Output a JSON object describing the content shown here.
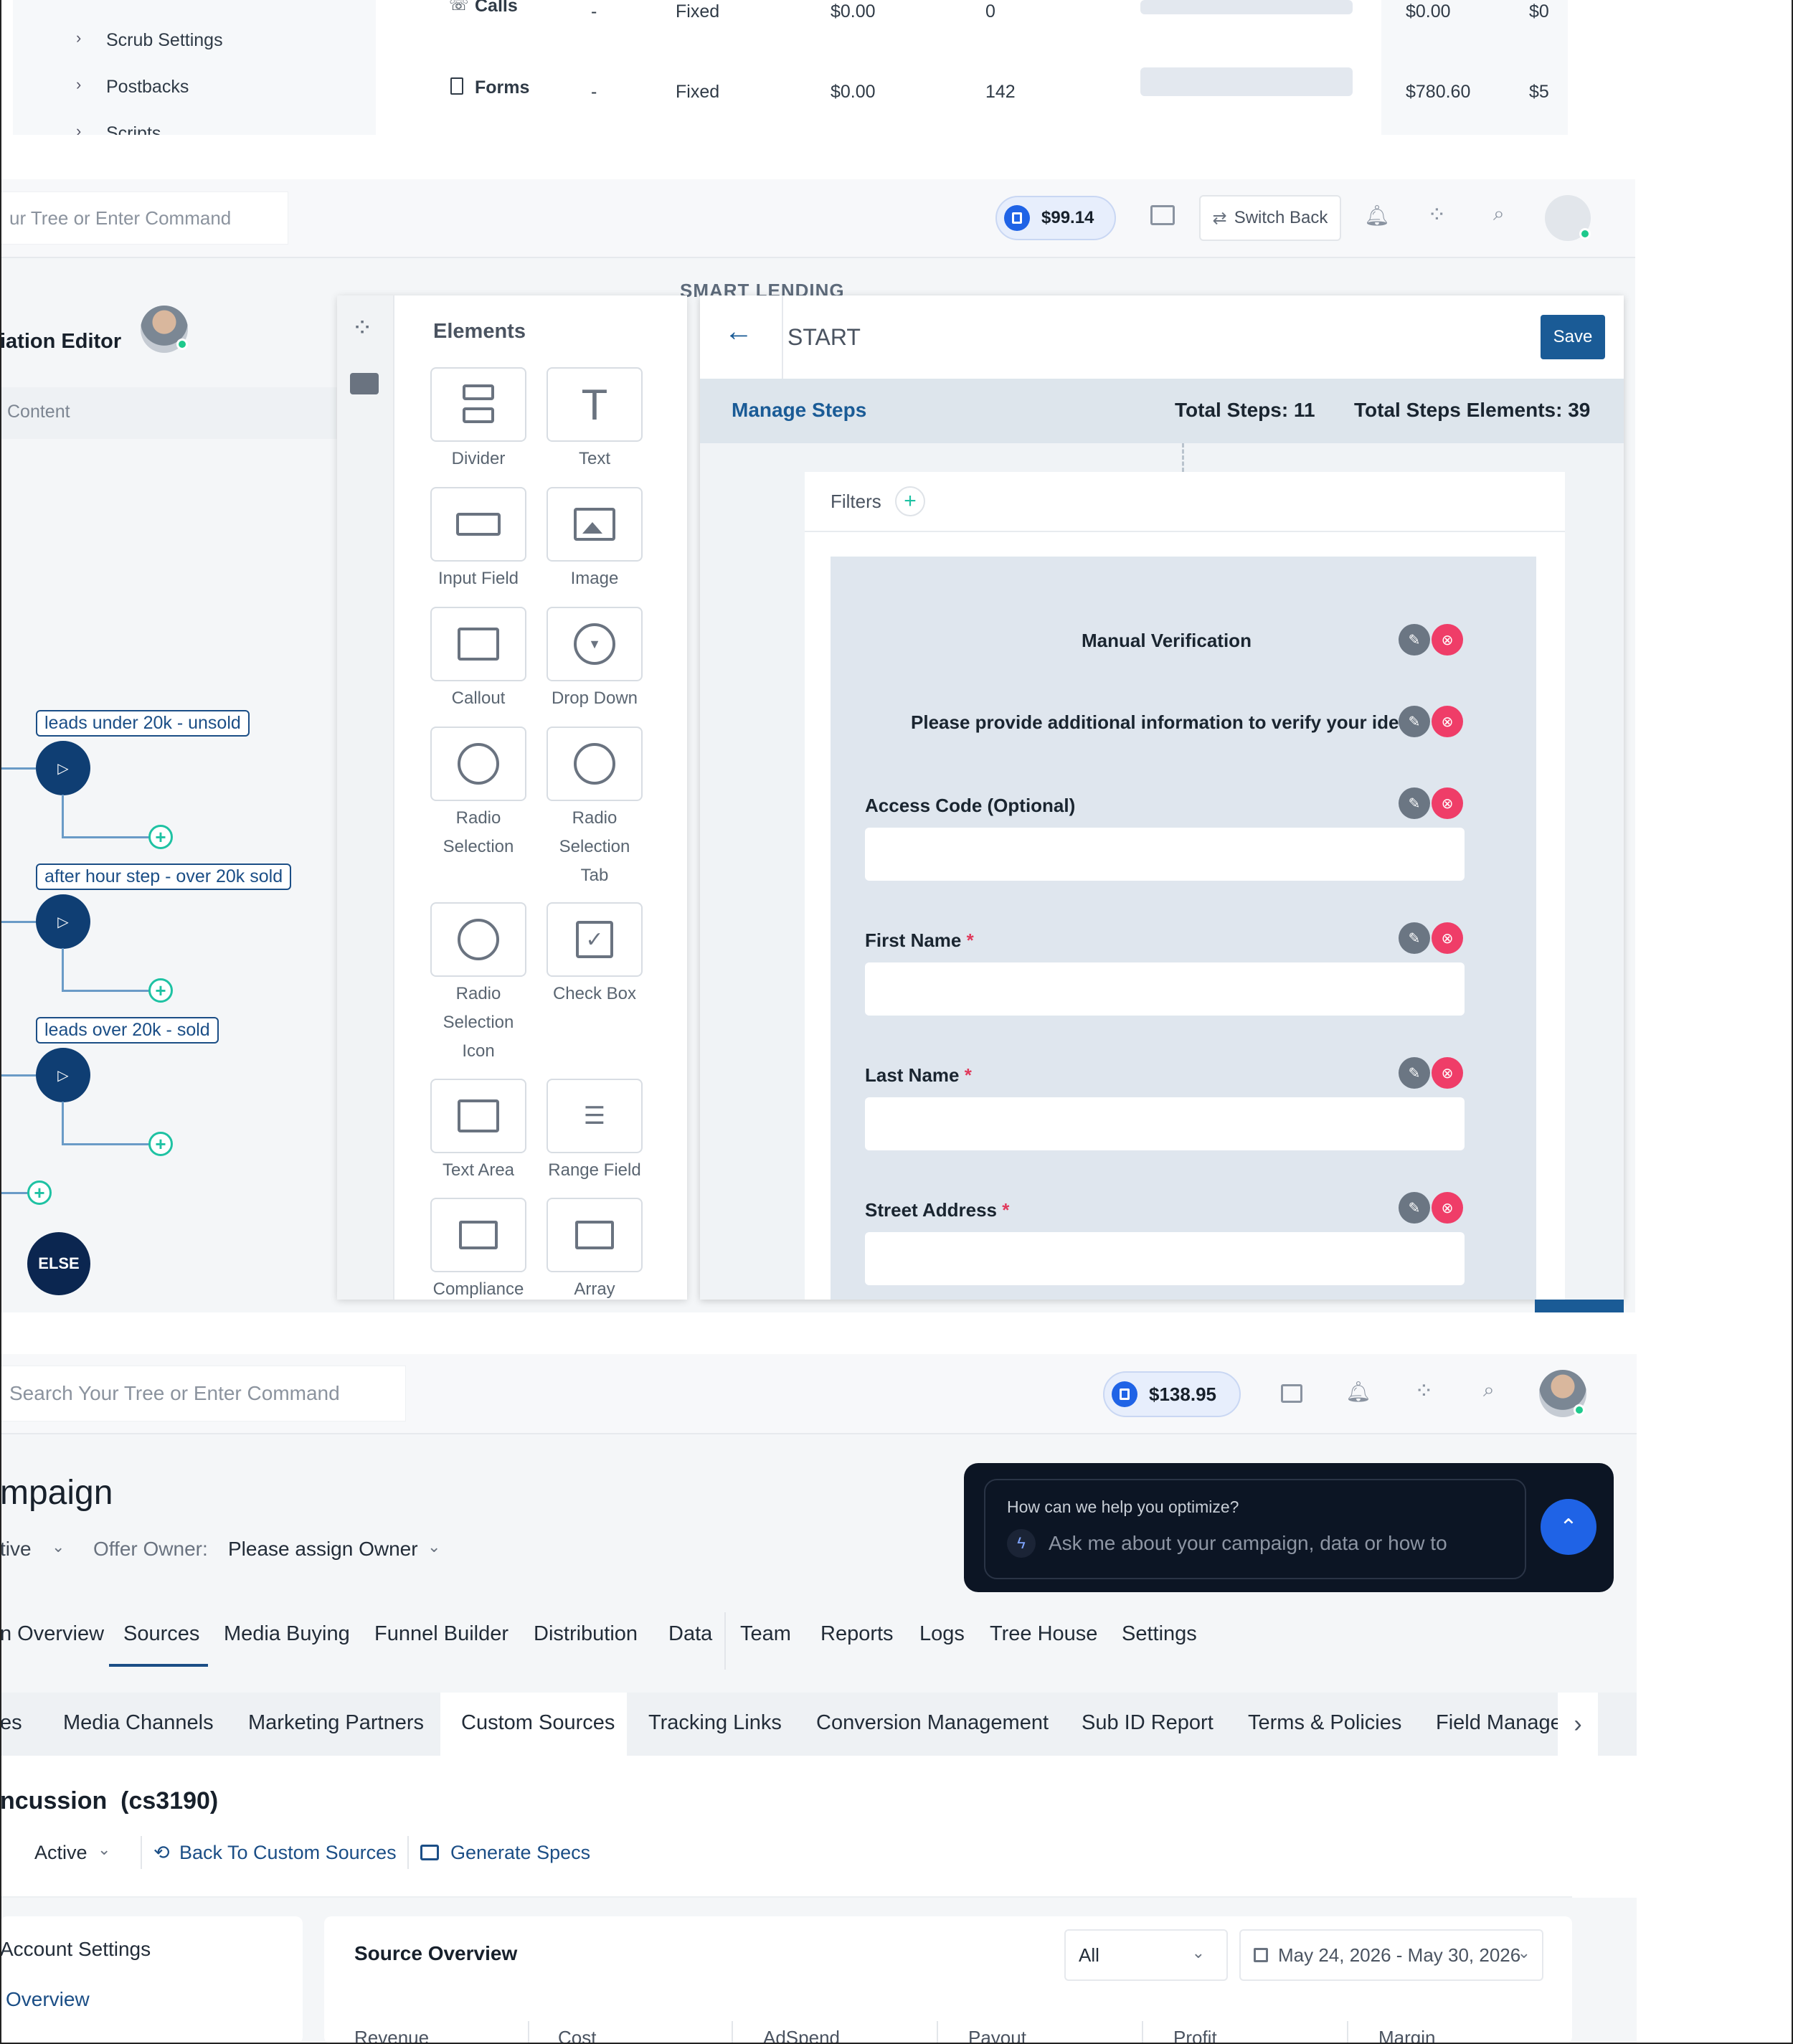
{
  "top": {
    "menu": [
      "Scrub Settings",
      "Postbacks",
      "Scripts"
    ],
    "rows": [
      {
        "icon": "phone-icon",
        "name": "Calls",
        "dash": "-",
        "type": "Fixed",
        "price": "$0.00",
        "count": "0",
        "revenue": "$0.00",
        "cut": "$0"
      },
      {
        "icon": "form-icon",
        "name": "Forms",
        "dash": "-",
        "type": "Fixed",
        "price": "$0.00",
        "count": "142",
        "revenue": "$780.60",
        "cut": "$5"
      }
    ]
  },
  "editor": {
    "search_placeholder": "ur Tree or Enter Command",
    "balance": "$99.14",
    "switch_back": "Switch Back",
    "page_title": "iation Editor",
    "content_tab": "Content",
    "smart_lending": "SMART LENDING",
    "flow": {
      "labels": [
        "leads under 20k - unsold",
        "after hour step - over 20k sold",
        "leads over 20k - sold"
      ],
      "else": "ELSE"
    },
    "elements": {
      "title": "Elements",
      "items": [
        "Divider",
        "Text",
        "Input Field",
        "Image",
        "Callout",
        "Drop Down",
        "Radio Selection",
        "Radio Selection Tab",
        "Radio Selection Icon",
        "Check Box",
        "Text Area",
        "Range Field",
        "Compliance",
        "Array"
      ],
      "label_lines": {
        "radio_selection": [
          "Radio",
          "Selection"
        ],
        "radio_selection_tab": [
          "Radio",
          "Selection",
          "Tab"
        ],
        "radio_selection_icon": [
          "Radio",
          "Selection",
          "Icon"
        ]
      }
    },
    "step": {
      "title": "START",
      "save": "Save",
      "manage_steps": "Manage Steps",
      "total_steps": "Total Steps: 11",
      "total_elements": "Total Steps Elements: 39",
      "filters": "Filters",
      "heading": "Manual Verification",
      "subheading": "Please provide additional information to verify your identi",
      "fields": [
        {
          "label": "Access Code (Optional)",
          "required": false
        },
        {
          "label": "First Name",
          "required": true
        },
        {
          "label": "Last Name",
          "required": true
        },
        {
          "label": "Street Address",
          "required": true
        }
      ],
      "required_mark": "*"
    }
  },
  "campaign": {
    "search_placeholder": "Search Your Tree or Enter Command",
    "balance": "$138.95",
    "title": "mpaign",
    "status": "tive",
    "offer_owner_label": "Offer Owner:",
    "offer_owner_value": "Please assign Owner",
    "chat": {
      "prompt": "How can we help you optimize?",
      "placeholder": "Ask me about your campaign, data or how to"
    },
    "tabs": [
      "n Overview",
      "Sources",
      "Media Buying",
      "Funnel Builder",
      "Distribution",
      "Data",
      "Team",
      "Reports",
      "Logs",
      "Tree House",
      "Settings"
    ],
    "active_tab": "Sources",
    "subtabs": [
      "es",
      "Media Channels",
      "Marketing Partners",
      "Custom Sources",
      "Tracking Links",
      "Conversion Management",
      "Sub ID Report",
      "Terms & Policies",
      "Field Managem"
    ],
    "active_subtab": "Custom Sources",
    "source_title": "ncussion",
    "source_id": "(cs3190)",
    "source_status": "Active",
    "back_link": "Back To Custom Sources",
    "specs_link": "Generate Specs",
    "side": [
      "Account Settings",
      "Overview"
    ],
    "overview": {
      "title": "Source Overview",
      "filter": "All",
      "date_range": "May 24, 2026 - May 30, 2026",
      "columns": [
        "Revenue",
        "Cost",
        "AdSpend",
        "Payout",
        "Profit",
        "Margin"
      ]
    }
  },
  "colors": {
    "accent": "#1f63e6",
    "navy": "#0f3e73",
    "teal": "#1ec2a3",
    "danger": "#ef3d68"
  }
}
